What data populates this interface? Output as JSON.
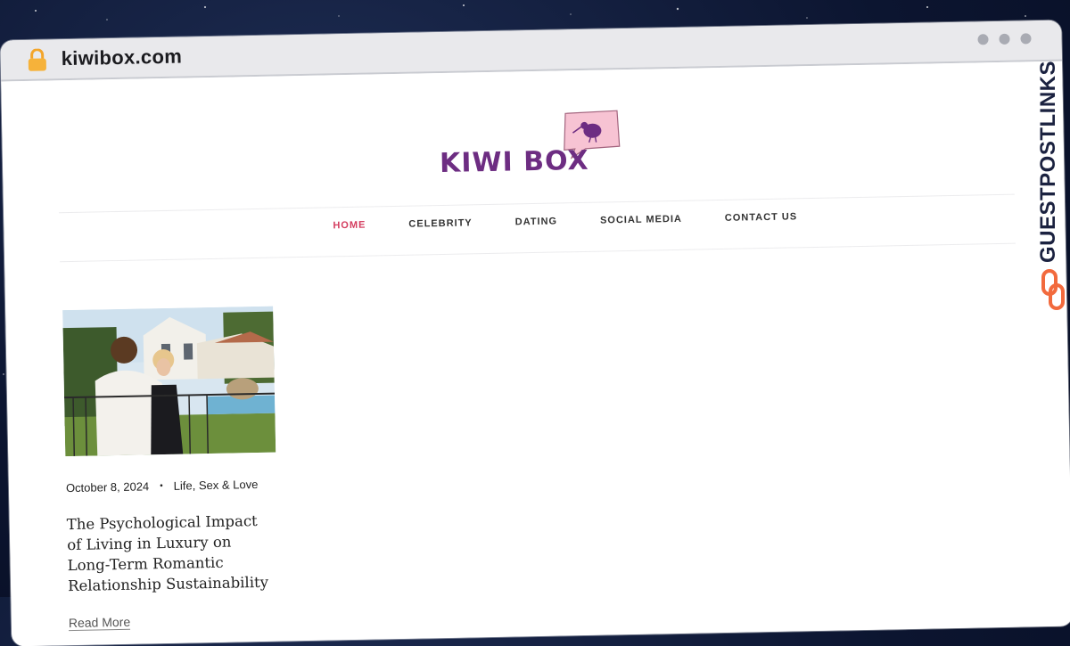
{
  "browser": {
    "url": "kiwibox.com"
  },
  "site": {
    "logo_text": "KIWI BOX"
  },
  "nav": {
    "items": [
      {
        "label": "HOME",
        "active": true
      },
      {
        "label": "CELEBRITY",
        "active": false
      },
      {
        "label": "DATING",
        "active": false
      },
      {
        "label": "SOCIAL MEDIA",
        "active": false
      },
      {
        "label": "CONTACT US",
        "active": false
      }
    ]
  },
  "post": {
    "date": "October 8, 2024",
    "category": "Life, Sex & Love",
    "title": "The Psychological Impact of Living in Luxury on Long-Term Romantic Relationship Sustainability",
    "read_more": "Read More"
  },
  "badge": {
    "text": "GUESTPOSTLINKS"
  },
  "colors": {
    "accent": "#d43d5f",
    "logo": "#6d2d82",
    "bubble": "#f7c3d3",
    "badge_icon": "#f26a3d",
    "background": "#0c1530"
  },
  "icons": [
    "lock-icon",
    "kiwi-bird-icon",
    "chain-link-icon"
  ]
}
